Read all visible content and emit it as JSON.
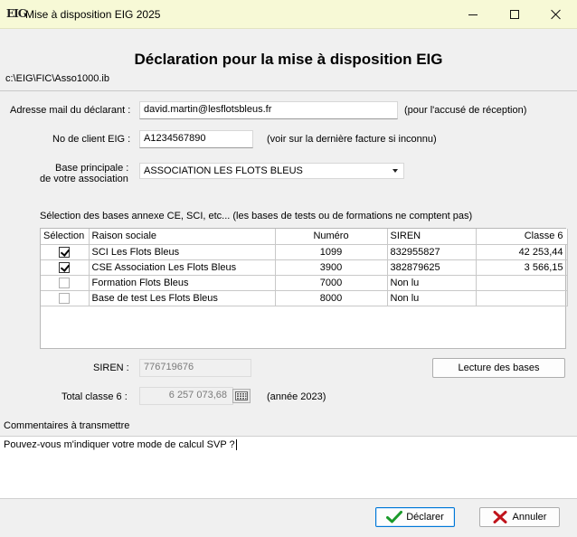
{
  "window": {
    "logo": "EIG",
    "title": "Mise à disposition EIG 2025"
  },
  "header": {
    "title": "Déclaration pour la mise à disposition EIG",
    "file_path": "c:\\EIG\\FIC\\Asso1000.ib"
  },
  "form": {
    "email": {
      "label": "Adresse mail du déclarant :",
      "value": "david.martin@lesflotsbleus.fr",
      "hint": "(pour l'accusé de réception)"
    },
    "client": {
      "label": "No de client EIG :",
      "value": "A1234567890",
      "hint": "(voir sur la dernière facture si inconnu)"
    },
    "base": {
      "label_line1": "Base principale :",
      "label_line2": "de votre association",
      "selected": "ASSOCIATION LES FLOTS BLEUS"
    }
  },
  "annex": {
    "caption": "Sélection des bases annexe CE, SCI, etc... (les bases de tests ou de formations ne comptent pas)",
    "columns": [
      "Sélection",
      "Raison sociale",
      "Numéro",
      "SIREN",
      "Classe 6"
    ],
    "rows": [
      {
        "selected": true,
        "name": "SCI Les Flots Bleus",
        "number": "1099",
        "siren": "832955827",
        "classe6": "42 253,44"
      },
      {
        "selected": true,
        "name": "CSE Association Les Flots Bleus",
        "number": "3900",
        "siren": "382879625",
        "classe6": "3 566,15"
      },
      {
        "selected": false,
        "name": "Formation Flots Bleus",
        "number": "7000",
        "siren": "Non lu",
        "classe6": ""
      },
      {
        "selected": false,
        "name": "Base de test Les Flots Bleus",
        "number": "8000",
        "siren": "Non lu",
        "classe6": ""
      }
    ]
  },
  "summary": {
    "siren_label": "SIREN :",
    "siren_value": "776719676",
    "read_button": "Lecture des bases",
    "total_label": "Total classe 6 :",
    "total_value": "6 257 073,68",
    "year_note": "(année 2023)"
  },
  "comments": {
    "label": "Commentaires à transmettre",
    "text": "Pouvez-vous m'indiquer votre mode de calcul SVP ?"
  },
  "actions": {
    "declare": "Déclarer",
    "cancel": "Annuler"
  },
  "colors": {
    "titlebar": "#f7f9d6",
    "check_green": "#1a9a2a",
    "cancel_red": "#c0141c",
    "focus_blue": "#0078d7"
  }
}
